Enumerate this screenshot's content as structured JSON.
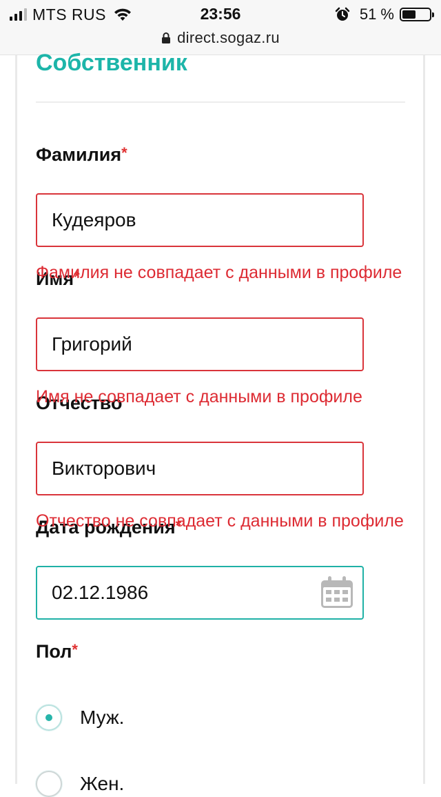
{
  "statusbar": {
    "carrier": "MTS RUS",
    "time": "23:56",
    "battery_pct": "51 %",
    "battery_level": 0.51,
    "url": "direct.sogaz.ru"
  },
  "form": {
    "section_title": "Собственник",
    "required_mark": "*",
    "fields": {
      "lastname": {
        "label": "Фамилия",
        "value": "Кудеяров",
        "error": "Фамилия не совпадает с данными в профиле"
      },
      "firstname": {
        "label": "Имя",
        "value": "Григорий",
        "error": "Имя не совпадает с данными в профиле"
      },
      "patronymic": {
        "label": "Отчество",
        "value": "Викторович",
        "error": "Отчество не совпадает с данными в профиле"
      },
      "birthdate": {
        "label": "Дата рождения",
        "value": "02.12.1986"
      }
    },
    "gender": {
      "label": "Пол",
      "options": [
        {
          "label": "Муж.",
          "checked": true
        },
        {
          "label": "Жен.",
          "checked": false
        }
      ]
    }
  },
  "icons": {
    "signal": "signal-bars-icon",
    "wifi": "wifi-icon",
    "alarm": "alarm-icon",
    "battery": "battery-icon",
    "lock": "lock-icon",
    "calendar": "calendar-icon"
  },
  "colors": {
    "accent": "#1db5a9",
    "error": "#dd2b33",
    "error_border": "#d9343a"
  }
}
